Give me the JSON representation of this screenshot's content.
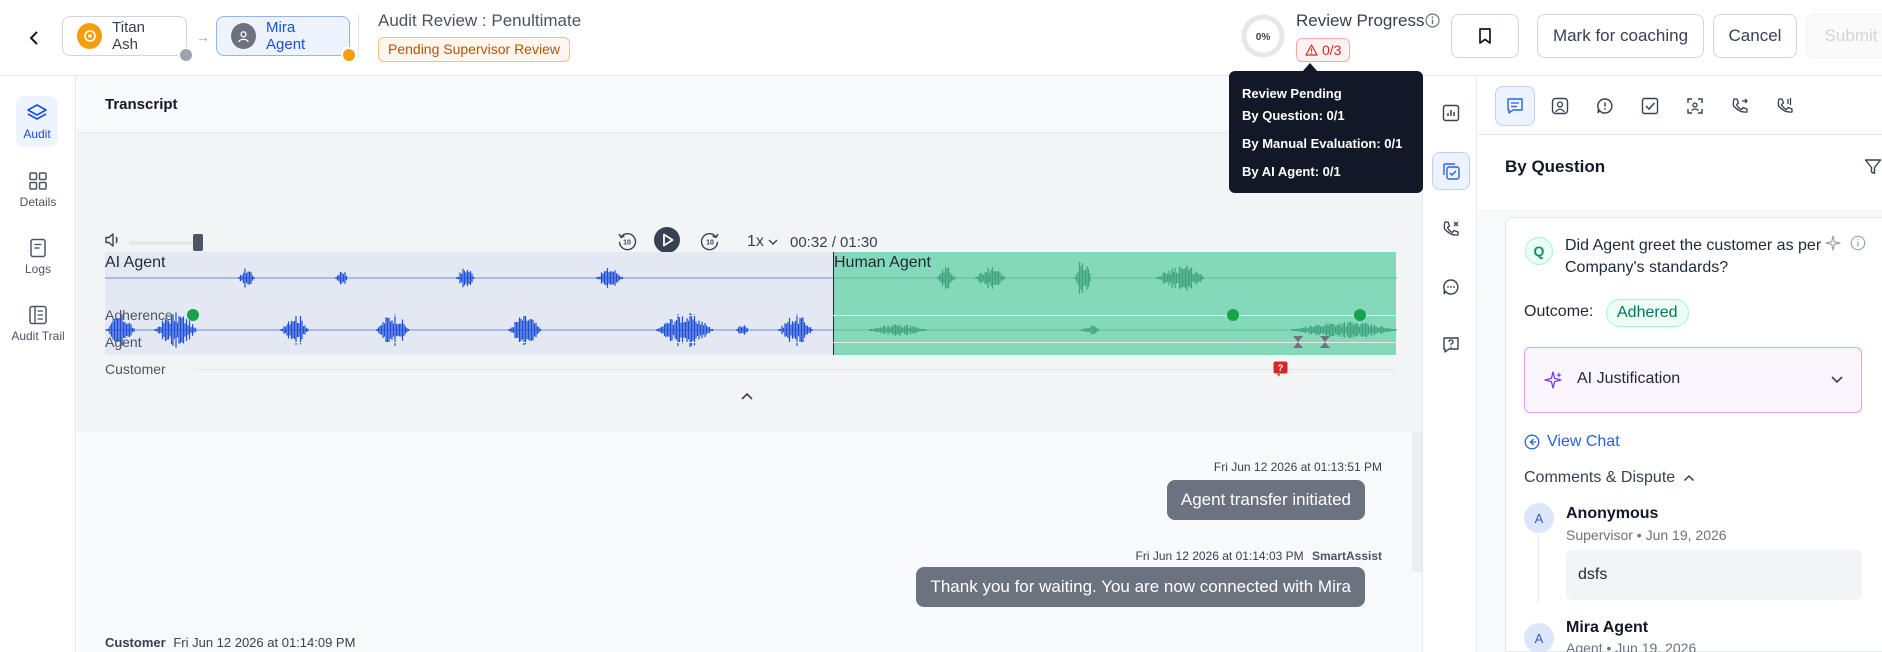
{
  "header": {
    "participant_1": "Titan Ash",
    "participant_2": "Mira Agent",
    "title": "Audit Review : Penultimate",
    "status": "Pending Supervisor Review",
    "progress_percent": "0%",
    "progress_label": "Review Progress",
    "warning_count": "0/3",
    "mark_coaching": "Mark for coaching",
    "cancel": "Cancel",
    "submit": "Submit"
  },
  "tooltip": {
    "title": "Review Pending",
    "by_question": "By Question: 0/1",
    "by_manual": "By Manual Evaluation: 0/1",
    "by_ai": "By AI Agent: 0/1"
  },
  "leftnav": {
    "items": [
      {
        "label": "Audit",
        "icon": "layers-icon"
      },
      {
        "label": "Details",
        "icon": "grid-icon"
      },
      {
        "label": "Logs",
        "icon": "document-icon"
      },
      {
        "label": "Audit Trail",
        "icon": "list-icon"
      }
    ]
  },
  "transcript": {
    "title": "Transcript",
    "speed": "1x",
    "time": "00:32 / 01:30",
    "ai_label": "AI Agent",
    "human_label": "Human Agent",
    "track_adherence": "Adherence",
    "track_agent": "Agent",
    "track_customer": "Customer",
    "playback_progress": 0.3556
  },
  "messages": [
    {
      "time": "Fri Jun 12 2026 at 01:13:51 PM",
      "sender": "",
      "text": "Agent transfer initiated"
    },
    {
      "time": "Fri Jun 12 2026 at 01:14:03 PM",
      "sender": "SmartAssist",
      "text": "Thank you for waiting. You are now connected with Mira"
    },
    {
      "sender": "Customer",
      "time": "Fri Jun 12 2026 at 01:14:09 PM"
    }
  ],
  "rightpanel": {
    "section_title": "By Question",
    "question_badge": "Q",
    "question": "Did Agent greet the customer as per Company's standards?",
    "outcome_label": "Outcome:",
    "outcome_value": "Adhered",
    "ai_justification": "AI Justification",
    "view_chat": "View Chat",
    "comments_title": "Comments & Dispute",
    "comments": [
      {
        "avatar": "A",
        "name": "Anonymous",
        "meta": "Supervisor • Jun 19, 2026",
        "text": "dsfs"
      },
      {
        "avatar": "A",
        "name": "Mira Agent",
        "meta": "Agent • Jun 19, 2026"
      }
    ]
  },
  "colors": {
    "accent": "#2563eb",
    "ai_wave_bg": "#e3e8f3",
    "human_wave_bg": "#84d9bb",
    "wave_ai": "#1d4ed8",
    "wave_human": "#3fa37f",
    "adherence_dot": "#16a34a"
  }
}
